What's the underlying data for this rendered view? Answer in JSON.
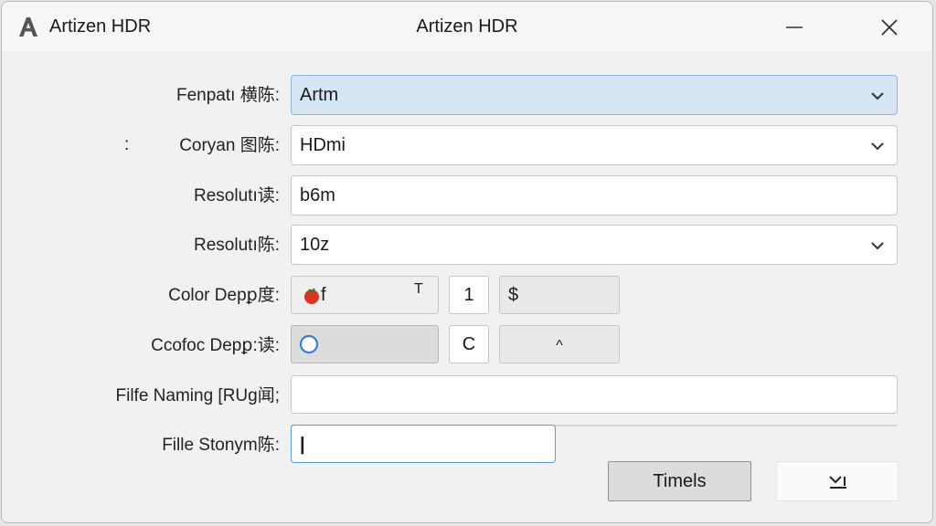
{
  "window": {
    "app_name": "Artizen HDR",
    "title": "Artizen HDR"
  },
  "form": {
    "stray_mark": ":",
    "rows": [
      {
        "label": "Fenpatı 横陈:",
        "value": "Artm"
      },
      {
        "label": "Coryan 图陈:",
        "value": "HDmi"
      },
      {
        "label": "Resolutı读:",
        "value": "b6m"
      },
      {
        "label": "Resolutı陈:",
        "value": "10z"
      },
      {
        "label": "Color Depꝑ度:",
        "value": "f",
        "box_t": "T",
        "box_num": "1",
        "box_s": "$"
      },
      {
        "label": "Ccofoc Depꝑ:读:",
        "value": "",
        "box_c": "C",
        "box_caret": "^"
      },
      {
        "label": "Filfe Naming [RUg闻;",
        "value": ""
      },
      {
        "label": "Fille Stonym陈:",
        "value": "|"
      }
    ]
  },
  "buttons": {
    "primary": "Timels",
    "secondary": "Ƴ"
  },
  "colors": {
    "highlight": "#d6e5f4",
    "accent_blue": "#3a7bd5",
    "tomato": "#d9361d"
  }
}
